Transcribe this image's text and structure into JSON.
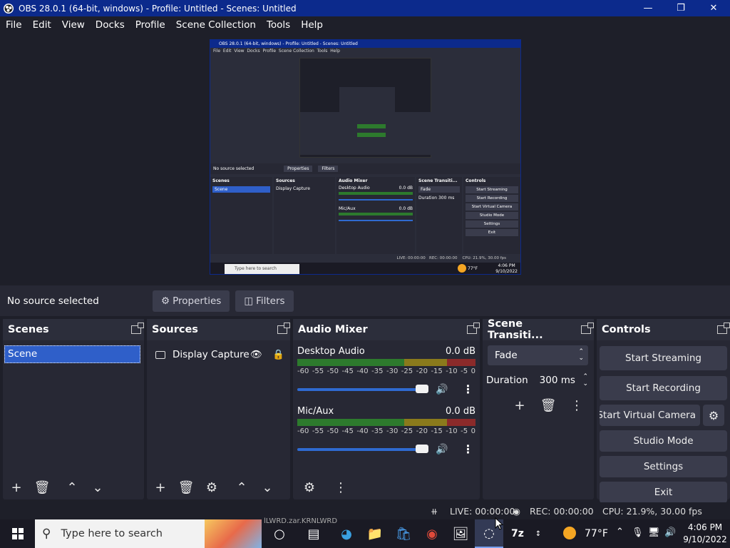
{
  "window": {
    "title": "OBS 28.0.1 (64-bit, windows) - Profile: Untitled - Scenes: Untitled"
  },
  "menu": [
    "File",
    "Edit",
    "View",
    "Docks",
    "Profile",
    "Scene Collection",
    "Tools",
    "Help"
  ],
  "source_bar": {
    "status": "No source selected",
    "properties_label": "Properties",
    "filters_label": "Filters"
  },
  "scenes": {
    "title": "Scenes",
    "items": [
      "Scene"
    ]
  },
  "sources": {
    "title": "Sources",
    "items": [
      {
        "label": "Display Capture"
      }
    ]
  },
  "audio_mixer": {
    "title": "Audio Mixer",
    "scale": [
      "-60",
      "-55",
      "-50",
      "-45",
      "-40",
      "-35",
      "-30",
      "-25",
      "-20",
      "-15",
      "-10",
      "-5",
      "0"
    ],
    "channels": [
      {
        "name": "Desktop Audio",
        "db": "0.0 dB",
        "volume": 1.0
      },
      {
        "name": "Mic/Aux",
        "db": "0.0 dB",
        "volume": 1.0
      }
    ]
  },
  "transitions": {
    "title": "Scene Transiti...",
    "selected": "Fade",
    "duration_label": "Duration",
    "duration_value": "300 ms"
  },
  "controls": {
    "title": "Controls",
    "start_streaming": "Start Streaming",
    "start_recording": "Start Recording",
    "start_virtual_camera": "Start Virtual Camera",
    "studio_mode": "Studio Mode",
    "settings": "Settings",
    "exit": "Exit"
  },
  "status": {
    "live": "LIVE: 00:00:00",
    "rec": "REC: 00:00:00",
    "cpu": "CPU: 21.9%, 30.00 fps"
  },
  "taskbar": {
    "search_placeholder": "Type here to search",
    "overlay_text": "lLWRD.zar.KRNLWRD",
    "weather": "77°F",
    "time": "4:06 PM",
    "date": "9/10/2022"
  },
  "mini_preview": {
    "title": "OBS 28.0.1 (64-bit, windows) - Profile: Untitled - Scenes: Untitled",
    "menu": [
      "File",
      "Edit",
      "View",
      "Docks",
      "Profile",
      "Scene Collection",
      "Tools",
      "Help"
    ],
    "status_text": "No source selected",
    "properties": "Properties",
    "filters": "Filters",
    "scenes": "Scenes",
    "sources": "Sources",
    "audio_mixer": "Audio Mixer",
    "transitions": "Scene Transiti...",
    "controls": "Controls",
    "scene_item": "Scene",
    "source_item": "Display Capture",
    "desktop_audio": "Desktop Audio",
    "mic_aux": "Mic/Aux",
    "db": "0.0 dB",
    "fade": "Fade",
    "duration": "Duration",
    "duration_value": "300 ms",
    "buttons": [
      "Start Streaming",
      "Start Recording",
      "Start Virtual Camera",
      "Studio Mode",
      "Settings",
      "Exit"
    ],
    "live": "LIVE: 00:00:00",
    "rec": "REC: 00:00:00",
    "cpu": "CPU: 21.9%, 30.00 fps",
    "search": "Type here to search",
    "time": "4:06 PM",
    "date": "9/10/2022",
    "weather": "77°F"
  }
}
